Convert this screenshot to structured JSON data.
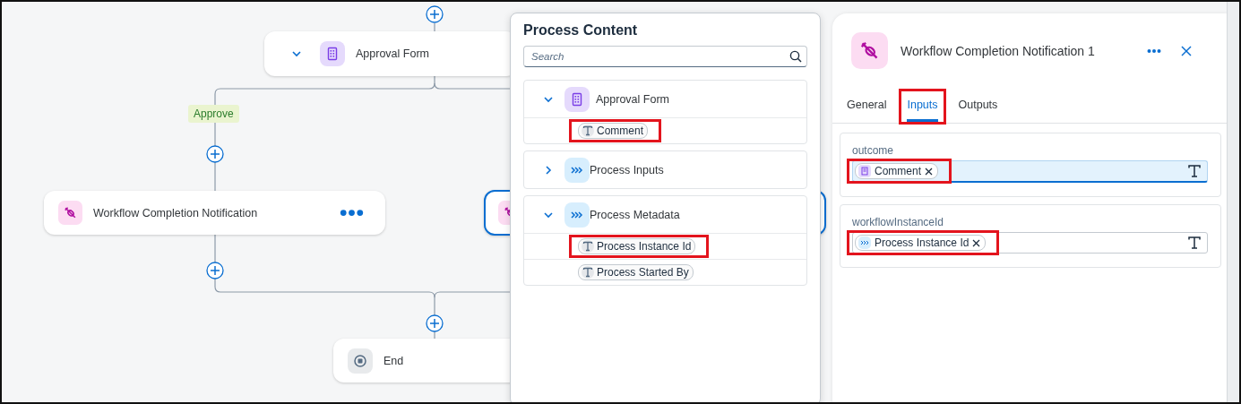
{
  "canvas": {
    "nodes": [
      {
        "kind": "form",
        "title": "Approval Form",
        "expanded": true,
        "selected": false
      },
      {
        "kind": "notification",
        "title": "Workflow Completion Notification",
        "has_menu": true,
        "selected": false
      },
      {
        "kind": "notification",
        "selected": true
      },
      {
        "kind": "end",
        "title": "End",
        "selected": false
      }
    ],
    "edge_labels": [
      "Approve"
    ]
  },
  "process_content": {
    "title": "Process Content",
    "search": {
      "placeholder": "Search"
    },
    "groups": [
      {
        "kind": "form",
        "title": "Approval Form",
        "expanded": true,
        "children": [
          {
            "label": "Comment",
            "highlighted": true
          }
        ]
      },
      {
        "kind": "inputs",
        "title": "Process Inputs",
        "expanded": false
      },
      {
        "kind": "inputs",
        "title": "Process Metadata",
        "expanded": true,
        "children": [
          {
            "label": "Process Instance Id",
            "highlighted": true
          },
          {
            "label": "Process Started By",
            "highlighted": false
          }
        ]
      }
    ]
  },
  "details_panel": {
    "title": "Workflow Completion Notification 1",
    "tabs": [
      {
        "label": "General",
        "selected": false,
        "highlighted": false
      },
      {
        "label": "Inputs",
        "selected": true,
        "highlighted": true
      },
      {
        "label": "Outputs",
        "selected": false,
        "highlighted": false
      }
    ],
    "fields": [
      {
        "label": "outcome",
        "focused": true,
        "token": {
          "kind": "form",
          "label": "Comment",
          "highlighted": true
        }
      },
      {
        "label": "workflowInstanceId",
        "focused": false,
        "token": {
          "kind": "inputs",
          "label": "Process Instance Id",
          "highlighted": true
        }
      }
    ]
  }
}
